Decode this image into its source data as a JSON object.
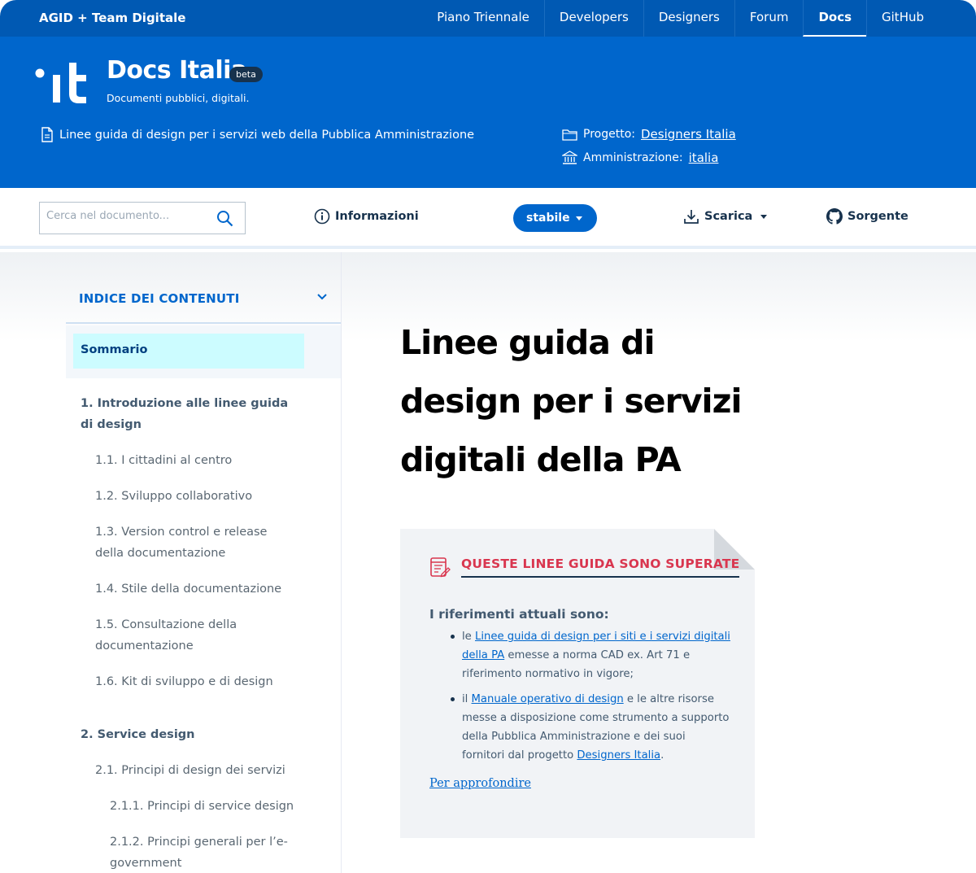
{
  "topbar": {
    "org": "AGID + Team Digitale",
    "nav": [
      "Piano Triennale",
      "Developers",
      "Designers",
      "Forum",
      "Docs",
      "GitHub"
    ],
    "active": "Docs"
  },
  "header": {
    "brand_title": "Docs Italia",
    "badge": "beta",
    "subtitle": "Documenti pubblici, digitali.",
    "doc_title": "Linee guida di design per i servizi web della Pubblica Amministrazione",
    "project_label": "Progetto:",
    "project_value": "Designers Italia",
    "admin_label": "Amministrazione:",
    "admin_value": "italia"
  },
  "toolbar": {
    "search_placeholder": "Cerca nel documento...",
    "info": "Informazioni",
    "version": "stabile",
    "download": "Scarica",
    "source": "Sorgente"
  },
  "sidebar": {
    "title": "INDICE DEI CONTENUTI",
    "active": "Sommario",
    "items": [
      {
        "text": "1. Introduzione alle linee guida di design",
        "level": 1
      },
      {
        "text": "1.1. I cittadini al centro",
        "level": 2
      },
      {
        "text": "1.2. Sviluppo collaborativo",
        "level": 2
      },
      {
        "text": "1.3. Version control e release della documentazione",
        "level": 2
      },
      {
        "text": "1.4. Stile della documentazione",
        "level": 2
      },
      {
        "text": "1.5. Consultazione della documentazione",
        "level": 2
      },
      {
        "text": "1.6. Kit di sviluppo e di design",
        "level": 2
      },
      {
        "text": "2. Service design",
        "level": 1
      },
      {
        "text": "2.1. Principi di design dei servizi",
        "level": 2
      },
      {
        "text": "2.1.1. Principi di service design",
        "level": 3
      },
      {
        "text": "2.1.2. Principi generali per l’e-government",
        "level": 3
      }
    ]
  },
  "main": {
    "title": "Linee guida di design per i servizi digitali della PA",
    "notice": {
      "title": "QUESTE LINEE GUIDA SONO SUPERATE",
      "lead": "I riferimenti attuali sono:",
      "item1_pre": "le ",
      "item1_link": "Linee guida di design per i siti e i servizi digitali della PA",
      "item1_post": " emesse a norma CAD ex. Art 71 e riferimento normativo in vigore;",
      "item2_pre": "il ",
      "item2_link": "Manuale operativo di design",
      "item2_post": " e le altre risorse messe a disposizione come strumento a supporto della Pubblica Amministrazione e dei suoi fornitori dal progetto ",
      "item2_link2": "Designers Italia",
      "item2_end": ".",
      "more": "Per approfondire"
    }
  },
  "colors": {
    "brand_blue": "#0066cc",
    "topbar_blue": "#0059b3",
    "warning_red": "#d9364f",
    "highlight": "#ccfcff"
  },
  "icons": [
    "it-logo",
    "document-icon",
    "folder-icon",
    "institution-icon",
    "search-icon",
    "info-icon",
    "download-icon",
    "github-icon",
    "chevron-down-icon",
    "notice-document-icon"
  ]
}
